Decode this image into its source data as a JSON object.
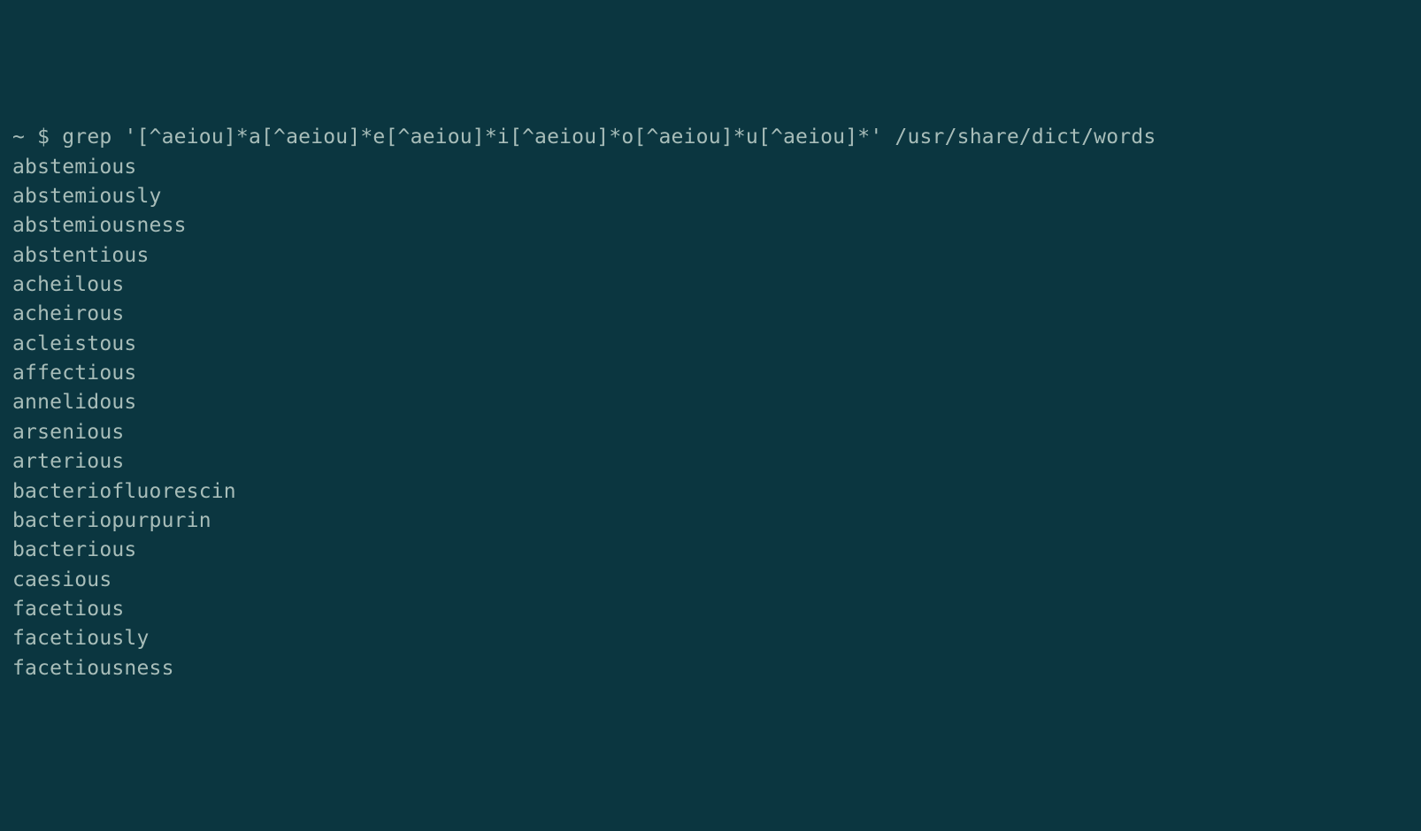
{
  "terminal": {
    "prompt": {
      "cwd": "~",
      "symbol": "$",
      "command": "grep '[^aeiou]*a[^aeiou]*e[^aeiou]*i[^aeiou]*o[^aeiou]*u[^aeiou]*' /usr/share/dict/words"
    },
    "output": [
      "abstemious",
      "abstemiously",
      "abstemiousness",
      "abstentious",
      "acheilous",
      "acheirous",
      "acleistous",
      "affectious",
      "annelidous",
      "arsenious",
      "arterious",
      "bacteriofluorescin",
      "bacteriopurpurin",
      "bacterious",
      "caesious",
      "facetious",
      "facetiously",
      "facetiousness"
    ]
  }
}
